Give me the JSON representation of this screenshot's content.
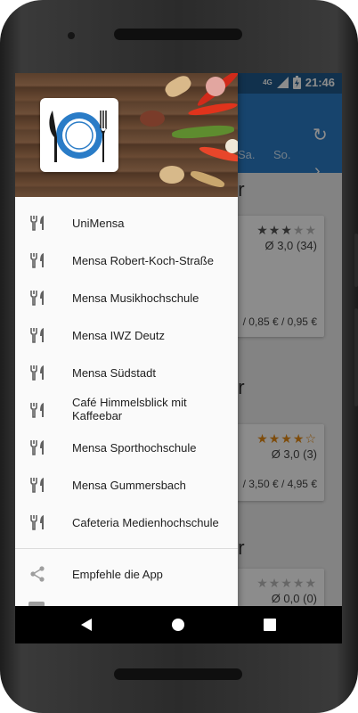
{
  "status_bar": {
    "network": "4G",
    "time": "21:46"
  },
  "app_bar": {
    "days": [
      "Sa.",
      "So."
    ]
  },
  "background_content": {
    "headings": [
      "hr",
      "hr",
      "hr"
    ],
    "cards": [
      {
        "rating": "Ø 3,0 (34)",
        "price": "/ 0,85 € / 0,95 €"
      },
      {
        "rating": "Ø 3,0 (3)",
        "price": "/ 3,50 € / 4,95 €"
      },
      {
        "rating": "Ø 0,0 (0)"
      }
    ],
    "star_color_gray": "#555555",
    "star_color_orange": "#e58a14"
  },
  "drawer": {
    "items": [
      {
        "label": "UniMensa",
        "icon": "fork-knife-icon"
      },
      {
        "label": "Mensa Robert-Koch-Straße",
        "icon": "fork-knife-icon"
      },
      {
        "label": "Mensa Musikhochschule",
        "icon": "fork-knife-icon"
      },
      {
        "label": "Mensa IWZ Deutz",
        "icon": "fork-knife-icon"
      },
      {
        "label": "Mensa Südstadt",
        "icon": "fork-knife-icon"
      },
      {
        "label": "Café Himmelsblick mit Kaffeebar",
        "icon": "fork-knife-icon"
      },
      {
        "label": "Mensa Sporthochschule",
        "icon": "fork-knife-icon"
      },
      {
        "label": "Mensa Gummersbach",
        "icon": "fork-knife-icon"
      },
      {
        "label": "Cafeteria Medienhochschule",
        "icon": "fork-knife-icon"
      }
    ],
    "share": {
      "label": "Empfehle die App",
      "icon": "share-icon"
    }
  },
  "colors": {
    "primary": "#2a7cc7",
    "status_bar": "#1f5a8c"
  }
}
